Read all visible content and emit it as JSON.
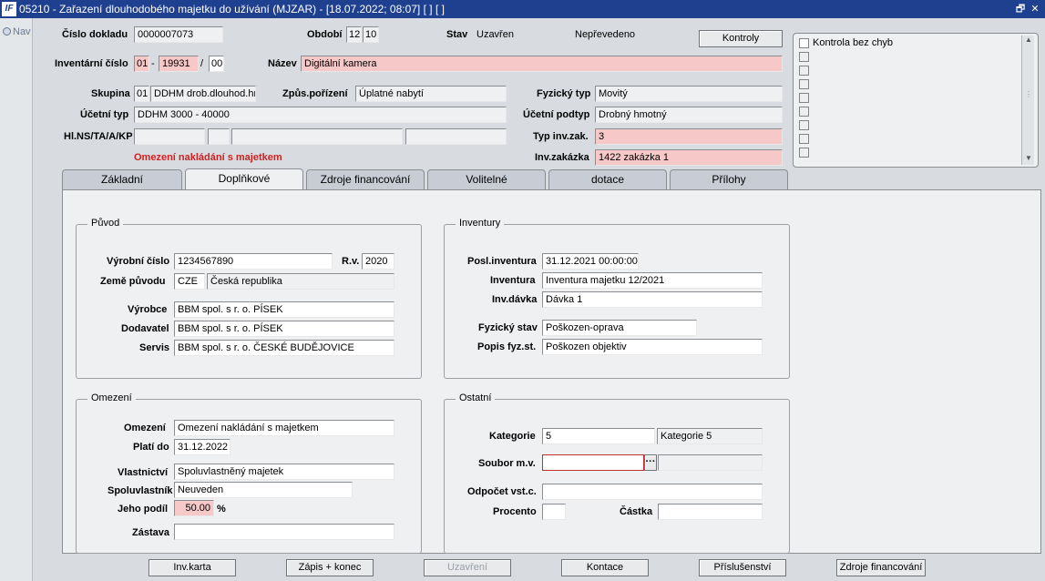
{
  "window": {
    "title": "05210 - Zařazení dlouhodobého majetku do užívání (MJZAR) - [18.07.2022; 08:07]  [ ]  [ ]",
    "app_icon": "IF",
    "restore_icon": "🗗",
    "close_icon": "✕"
  },
  "nav": {
    "label": "Nav"
  },
  "header": {
    "cislo_dokladu_label": "Číslo dokladu",
    "cislo_dokladu": "0000007073",
    "obdobi_label": "Období",
    "obdobi_1": "12",
    "obdobi_2": "10",
    "stav_label": "Stav",
    "stav": "Uzavřen",
    "neprevedeno": "Nepřevedeno",
    "kontroly_button": "Kontroly",
    "inv_cislo_label": "Inventární číslo",
    "inv_1": "01",
    "dash": "-",
    "inv_2": "19931",
    "slash": "/",
    "inv_3": "00",
    "nazev_label": "Název",
    "nazev": "Digitální kamera",
    "skupina_label": "Skupina",
    "skupina_code": "01",
    "skupina_name": "DDHM drob.dlouhod.hm",
    "zpusob_label": "Způs.pořízení",
    "zpusob": "Úplatné nabytí",
    "fyzicky_typ_label": "Fyzický typ",
    "fyzicky_typ": "Movitý",
    "ucetni_typ_label": "Účetní typ",
    "ucetni_typ": "DDHM 3000 - 40000",
    "ucetni_podtyp_label": "Účetní podtyp",
    "ucetni_podtyp": "Drobný hmotný",
    "hlns_label": "Hl.NS/TA/A/KP",
    "typ_inv_zak_label": "Typ inv.zak.",
    "typ_inv_zak": "3",
    "omezeni_warning": "Omezení nakládání s majetkem",
    "inv_zakazka_label": "Inv.zakázka",
    "inv_zakazka": "1422 zakázka 1"
  },
  "checklist": {
    "items": [
      "Kontrola bez chyb"
    ]
  },
  "tabs": [
    {
      "label": "Základní"
    },
    {
      "label": "Doplňkové"
    },
    {
      "label": "Zdroje financování"
    },
    {
      "label": "Volitelné"
    },
    {
      "label": "dotace"
    },
    {
      "label": "Přílohy"
    }
  ],
  "puvod": {
    "title": "Původ",
    "vyrobni_cislo_label": "Výrobní číslo",
    "vyrobni_cislo": "1234567890",
    "rv_label": "R.v.",
    "rv": "2020",
    "zeme_label": "Země původu",
    "zeme_code": "CZE",
    "zeme_name": "Česká republika",
    "vyrobce_label": "Výrobce",
    "vyrobce": "BBM spol. s r. o.  PÍSEK",
    "dodavatel_label": "Dodavatel",
    "dodavatel": "BBM spol. s r. o.  PÍSEK",
    "servis_label": "Servis",
    "servis": "BBM spol. s r. o.  ČESKÉ BUDĚJOVICE"
  },
  "inventury": {
    "title": "Inventury",
    "posl_label": "Posl.inventura",
    "posl": "31.12.2021 00:00:00",
    "inventura_label": "Inventura",
    "inventura": "Inventura majetku 12/2021",
    "davka_label": "Inv.dávka",
    "davka": "Dávka 1",
    "fyz_stav_label": "Fyzický stav",
    "fyz_stav": "Poškozen-oprava",
    "popis_label": "Popis fyz.st.",
    "popis": "Poškozen objektiv"
  },
  "omezeni": {
    "title": "Omezení",
    "omezeni_label": "Omezení",
    "omezeni": "Omezení nakládání s majetkem",
    "plati_label": "Platí do",
    "plati": "31.12.2022",
    "vlastnictvi_label": "Vlastnictví",
    "vlastnictvi": "Spoluvlastněný majetek",
    "spoluvlastnik_label": "Spoluvlastník",
    "spoluvlastnik": "Neuveden",
    "podil_label": "Jeho podíl",
    "podil": "50.00",
    "percent": "%",
    "zastava_label": "Zástava",
    "zastava": ""
  },
  "ostatni": {
    "title": "Ostatní",
    "kategorie_label": "Kategorie",
    "kategorie": "5",
    "kategorie_name": "Kategorie 5",
    "soubor_label": "Soubor m.v.",
    "soubor": "",
    "lov_button": "···",
    "odpocet_label": "Odpočet vst.c.",
    "odpocet": "",
    "procento_label": "Procento",
    "procento": "",
    "castka_label": "Částka",
    "castka": ""
  },
  "footer": {
    "inv_karta": "Inv.karta",
    "zapis_konec": "Zápis + konec",
    "uzavreni": "Uzavření",
    "kontace": "Kontace",
    "prislusenstvi": "Příslušenství",
    "zdroje": "Zdroje financování"
  }
}
